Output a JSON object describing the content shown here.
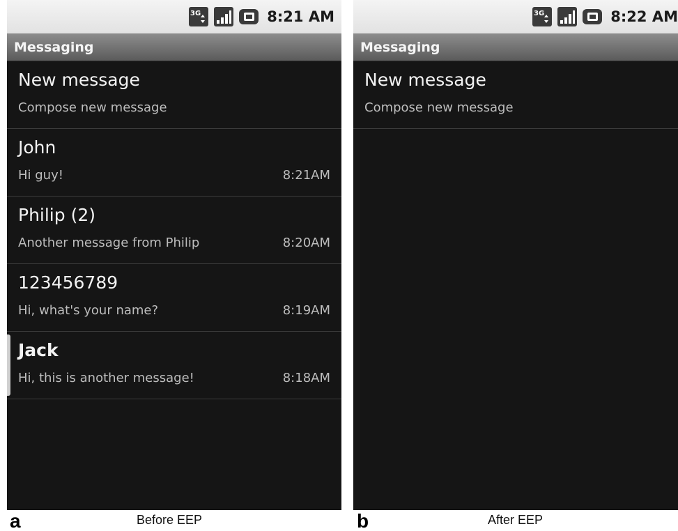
{
  "panel_a": {
    "letter": "a",
    "caption": "Before EEP",
    "status_bar": {
      "time": "8:21 AM",
      "icons": [
        "3g-data-icon",
        "signal-strength-icon",
        "battery-icon"
      ]
    },
    "app_title": "Messaging",
    "new_message": {
      "title": "New message",
      "subtitle": "Compose new message"
    },
    "conversations": [
      {
        "name": "John",
        "snippet": "Hi guy!",
        "time": "8:21AM",
        "unread": false
      },
      {
        "name": "Philip (2)",
        "snippet": "Another message from Philip",
        "time": "8:20AM",
        "unread": false
      },
      {
        "name": "123456789",
        "snippet": "Hi, what's your name?",
        "time": "8:19AM",
        "unread": false
      },
      {
        "name": "Jack",
        "snippet": "Hi, this is another message!",
        "time": "8:18AM",
        "unread": true
      }
    ]
  },
  "panel_b": {
    "letter": "b",
    "caption": "After EEP",
    "status_bar": {
      "time": "8:22 AM",
      "icons": [
        "3g-data-icon",
        "signal-strength-icon",
        "battery-icon"
      ]
    },
    "app_title": "Messaging",
    "new_message": {
      "title": "New message",
      "subtitle": "Compose new message"
    },
    "conversations": []
  },
  "colors": {
    "screen_background": "#151515",
    "status_bar": "#e8e8e8",
    "title_bar": "#6e6e6e",
    "primary_text": "#f2f2f2",
    "secondary_text": "#bdbdbd"
  }
}
